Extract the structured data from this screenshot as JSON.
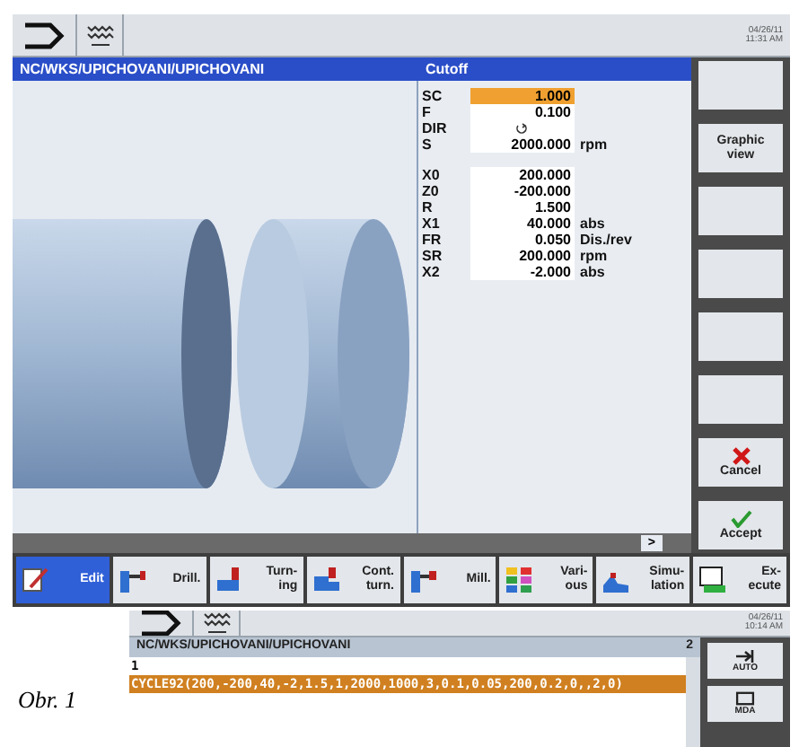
{
  "main_screen": {
    "date": "04/26/11",
    "time": "11:31 AM",
    "path": "NC/WKS/UPICHOVANI/UPICHOVANI",
    "panel_title": "Cutoff",
    "param_groups": [
      [
        {
          "label": "SC",
          "kind": "value",
          "value": "1.000",
          "selected": true
        },
        {
          "label": "F",
          "kind": "value",
          "value": "0.100",
          "selected": false
        },
        {
          "label": "DIR",
          "kind": "direction",
          "selected": false
        },
        {
          "label": "S",
          "kind": "value",
          "value": "2000.000",
          "unit": "rpm",
          "selected": false
        }
      ],
      [
        {
          "label": "X0",
          "kind": "value",
          "value": "200.000",
          "selected": false
        },
        {
          "label": "Z0",
          "kind": "value",
          "value": "-200.000",
          "selected": false
        },
        {
          "label": "R",
          "kind": "value",
          "value": "1.500",
          "selected": false
        },
        {
          "label": "X1",
          "kind": "value",
          "value": "40.000",
          "unit": "abs",
          "selected": false
        },
        {
          "label": "FR",
          "kind": "value",
          "value": "0.050",
          "unit": "Dis./rev",
          "selected": false
        },
        {
          "label": "SR",
          "kind": "value",
          "value": "200.000",
          "unit": "rpm",
          "selected": false
        },
        {
          "label": "X2",
          "kind": "value",
          "value": "-2.000",
          "unit": "abs",
          "selected": false
        }
      ]
    ],
    "softkeys": [
      {
        "kind": "empty"
      },
      {
        "kind": "text",
        "label": "Graphic view"
      },
      {
        "kind": "empty"
      },
      {
        "kind": "empty"
      },
      {
        "kind": "empty"
      },
      {
        "kind": "empty"
      },
      {
        "kind": "cancel",
        "label": "Cancel"
      },
      {
        "kind": "accept",
        "label": "Accept"
      }
    ],
    "scroll_arrow": ">",
    "tabs": [
      {
        "kind": "edit",
        "lines": [
          "Edit"
        ],
        "selected": true
      },
      {
        "kind": "drill",
        "lines": [
          "Drill."
        ],
        "selected": false
      },
      {
        "kind": "turning",
        "lines": [
          "Turn-",
          "ing"
        ],
        "selected": false
      },
      {
        "kind": "contour",
        "lines": [
          "Cont.",
          "turn."
        ],
        "selected": false
      },
      {
        "kind": "mill",
        "lines": [
          "Mill."
        ],
        "selected": false
      },
      {
        "kind": "various",
        "lines": [
          "Vari-",
          "ous"
        ],
        "selected": false
      },
      {
        "kind": "simulation",
        "lines": [
          "Simu-",
          "lation"
        ],
        "selected": false
      },
      {
        "kind": "execute",
        "lines": [
          "Ex-",
          "ecute"
        ],
        "selected": false
      }
    ]
  },
  "second_screen": {
    "date": "04/26/11",
    "time": "10:14 AM",
    "path": "NC/WKS/UPICHOVANI/UPICHOVANI",
    "line_count": "2",
    "lines": [
      {
        "text": "1",
        "selected": false
      },
      {
        "text": "CYCLE92(200,-200,40,-2,1.5,1,2000,1000,3,0.1,0.05,200,0.2,0,,2,0)",
        "selected": true
      }
    ],
    "softkeys": [
      {
        "kind": "auto",
        "label": "AUTO"
      },
      {
        "kind": "mda",
        "label": "MDA"
      }
    ]
  },
  "caption": "Obr. 1"
}
